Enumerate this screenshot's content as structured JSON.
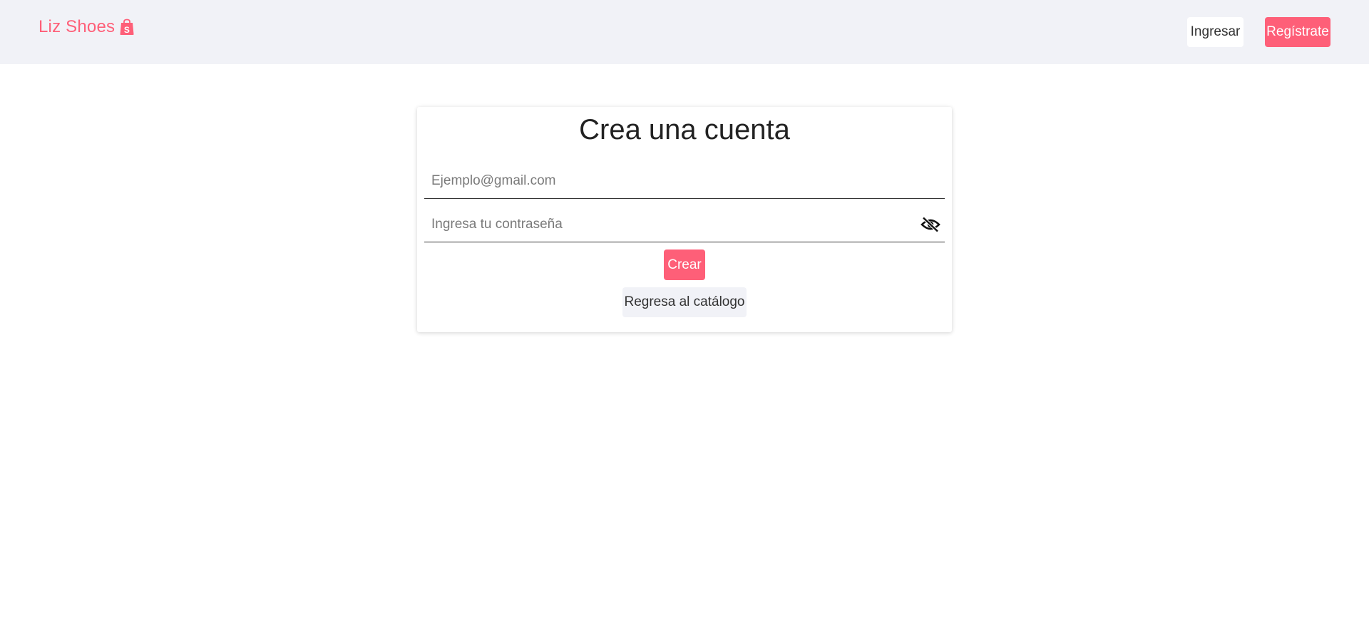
{
  "header": {
    "brand": "Liz Shoes",
    "brand_icon": "shopping-bag-icon",
    "login_label": "Ingresar",
    "register_label": "Regístrate"
  },
  "form": {
    "title": "Crea una cuenta",
    "email_placeholder": "Ejemplo@gmail.com",
    "password_placeholder": "Ingresa tu contraseña",
    "password_toggle_icon": "eye-slash-icon",
    "create_label": "Crear",
    "back_label": "Regresa al catálogo"
  },
  "colors": {
    "accent": "#fe5f78",
    "header_bg": "#f1f2f7",
    "page_bg": "#ffffff"
  }
}
